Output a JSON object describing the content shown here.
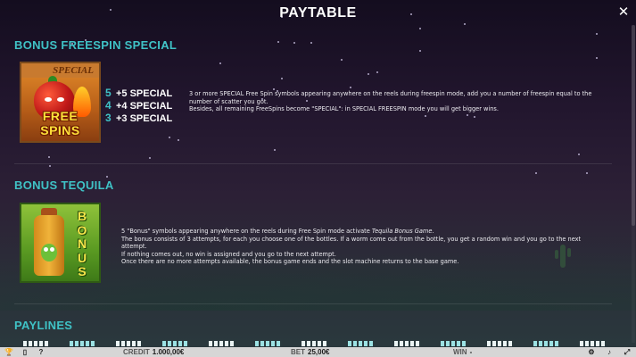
{
  "header": {
    "title": "PAYTABLE",
    "close_icon": "close-icon"
  },
  "sections": {
    "freespin": {
      "title": "BONUS FREESPIN SPECIAL",
      "symbol": {
        "top_text": "SPECIAL",
        "main_text": "FREE SPINS",
        "icon": "free-spins-pepper-symbol"
      },
      "pays": [
        {
          "count": "5",
          "value": "+5 SPECIAL"
        },
        {
          "count": "4",
          "value": "+4 SPECIAL"
        },
        {
          "count": "3",
          "value": "+3 SPECIAL"
        }
      ],
      "description": [
        "3 or more SPECIAL Free Spin symbols appearing anywhere on the reels during freespin mode, add you a number of freespin equal to the number of scatter you got.",
        "Besides, all remaining FreeSpins become \"SPECIAL\": in SPECIAL FREESPIN mode you will get bigger wins."
      ]
    },
    "tequila": {
      "title": "BONUS TEQUILA",
      "symbol": {
        "letters": [
          "B",
          "O",
          "N",
          "U",
          "S"
        ],
        "icon": "tequila-bottle-symbol"
      },
      "description": {
        "line1_prefix": "5 \"Bonus\" symbols appearing anywhere on the reels during Free Spin mode activate ",
        "line1_em": "Tequila Bonus Game",
        "line1_suffix": ".",
        "line2": "The bonus consists of 3 attempts, for each you choose one of the bottles. If a worm come out from the bottle, you get a random win and you go to the next attempt.",
        "line3": "If nothing comes out, no win is assigned and you go to the next attempt.",
        "line4": "Once there are no more attempts available, the bonus game ends and the slot machine returns to the base game."
      }
    },
    "paylines": {
      "title": "PAYLINES"
    }
  },
  "bottom_bar": {
    "icons": [
      "trophy-icon",
      "trash-icon",
      "help-icon"
    ],
    "credit_label": "CREDIT",
    "credit_value": "1.000,00€",
    "bet_label": "BET",
    "bet_value": "25,00€",
    "win_label": "WIN",
    "win_value": "-",
    "right_icons": [
      "settings-icon",
      "sound-icon",
      "fullscreen-icon"
    ]
  },
  "colors": {
    "accent_teal": "#3fc2c6",
    "background_top": "#140d1f",
    "bottom_bar": "#d6d6d6"
  }
}
